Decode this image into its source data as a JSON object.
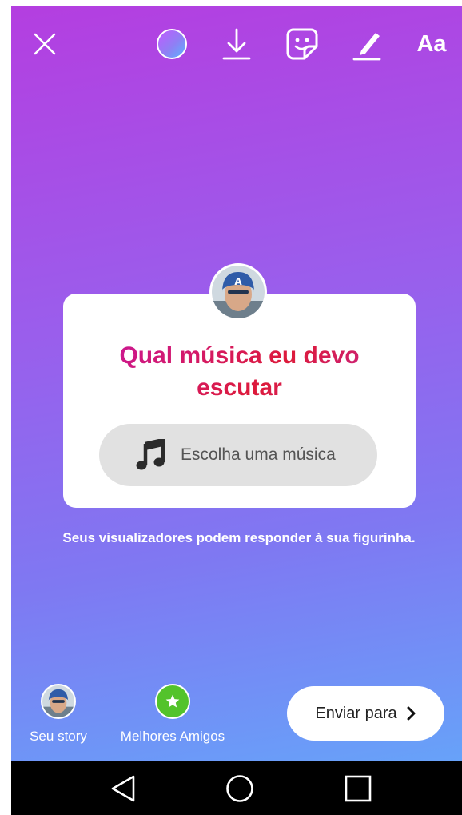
{
  "toolbar": {
    "close_icon": "close-icon",
    "color_icon": "color-picker-icon",
    "download_icon": "download-icon",
    "sticker_icon": "sticker-icon",
    "draw_icon": "pen-icon",
    "text_label": "Aa"
  },
  "question_sticker": {
    "question": "Qual música eu devo escutar",
    "answer_placeholder": "Escolha uma música",
    "answer_icon": "music-note-icon"
  },
  "hint": "Seus visualizadores podem responder à sua figurinha.",
  "share": {
    "your_story_label": "Seu story",
    "close_friends_label": "Melhores Amigos",
    "send_label": "Enviar para"
  },
  "colors": {
    "gradient_top": "#b43ee0",
    "gradient_bottom": "#67a2f9",
    "question_gradient_start": "#c9189d",
    "question_gradient_end": "#dd1a3a",
    "close_friends_green": "#53c32b"
  },
  "navbar": {
    "back_icon": "back-triangle-icon",
    "home_icon": "home-circle-icon",
    "recents_icon": "recents-square-icon"
  }
}
